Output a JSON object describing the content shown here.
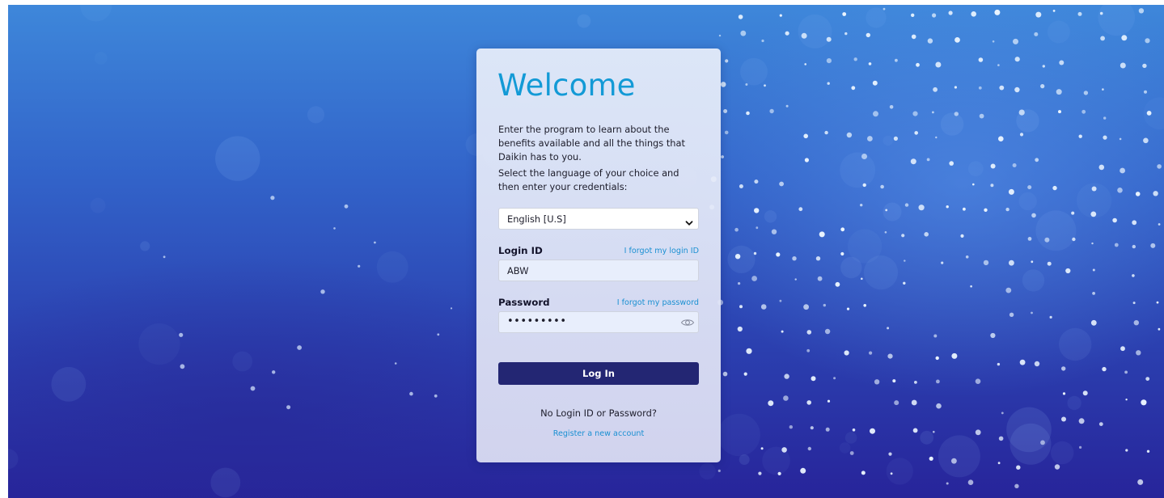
{
  "card": {
    "title": "Welcome",
    "intro_text": "Enter the program to learn about the benefits available and all the things that Daikin has to you.",
    "instruction_text": "Select the language of your choice and then enter your credentials:"
  },
  "language_select": {
    "selected": "English [U.S]",
    "icon": "chevron-down-icon"
  },
  "login_id": {
    "label": "Login ID",
    "forgot_link": "I forgot my login ID",
    "value": "ABW"
  },
  "password": {
    "label": "Password",
    "forgot_link": "I forgot my password",
    "value_masked": "•••••••••",
    "icon": "eye-icon"
  },
  "login_button": {
    "label": "Log In"
  },
  "footer": {
    "no_credentials_text": "No Login ID or Password?",
    "register_link": "Register a new account"
  },
  "colors": {
    "accent_title": "#139ad6",
    "link": "#1b90d2",
    "button": "#232673",
    "background_top": "#3e87da",
    "background_bottom": "#27249a"
  }
}
